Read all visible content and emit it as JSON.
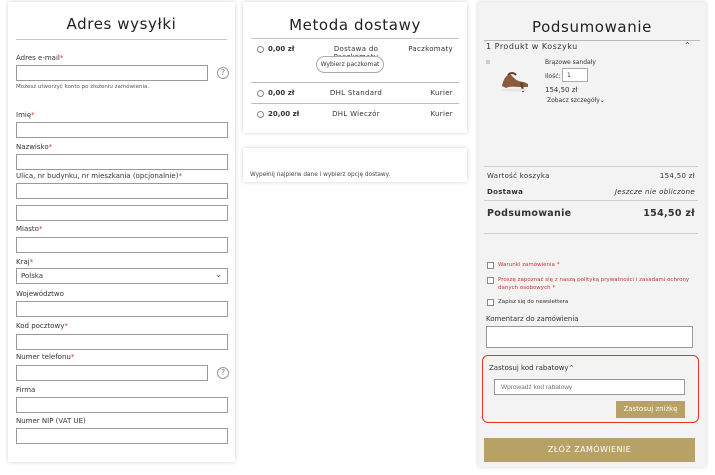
{
  "address": {
    "title": "Adres wysyłki",
    "email_label": "Adres e-mail",
    "email_hint": "Możesz utworzyć konto po złożeniu zamówienia.",
    "first_name_label": "Imię",
    "last_name_label": "Nazwisko",
    "street_label": "Ulica, nr budynku, nr mieszkania (opcjonalnie)",
    "city_label": "Miasto",
    "country_label": "Kraj",
    "country_value": "Polska",
    "region_label": "Województwo",
    "postcode_label": "Kod pocztowy",
    "phone_label": "Numer telefonu",
    "company_label": "Firma",
    "vat_label": "Numer NIP (VAT UE)",
    "required_mark": "*",
    "help_glyph": "?"
  },
  "shipping": {
    "title": "Metoda dostawy",
    "pick_button": "Wybierz paczkomat",
    "options": [
      {
        "price": "0,00 zł",
        "name": "Dostawa do Paczkomatu",
        "type": "Paczkomaty"
      },
      {
        "price": "0,00 zł",
        "name": "DHL Standard",
        "type": "Kurier"
      },
      {
        "price": "20,00 zł",
        "name": "DHL Wieczór",
        "type": "Kurier"
      }
    ],
    "info_text": "Wypełnij najpierw dane i wybierz opcję dostawy."
  },
  "summary": {
    "title": "Podsumowanie",
    "cart_header": "1 Produkt w Koszyku",
    "product_name": "Brązowe sandały",
    "qty_label": "Ilość:",
    "qty_value": "1",
    "product_price": "154,50 zł",
    "details_link": "Zobacz szczegóły",
    "cart_value_label": "Wartość koszyka",
    "cart_value": "154,50 zł",
    "delivery_label": "Dostawa",
    "delivery_value": "Jeszcze nie obliczone",
    "total_label": "Podsumowanie",
    "total_value": "154,50 zł",
    "terms_label": "Warunki zamówienia",
    "privacy_label": "Proszę zapoznać się z naszą polityką prywatności i zasadami ochrony danych osobowych",
    "newsletter_label": "Zapisz się do newslettera",
    "comment_label": "Komentarz do zamówienia",
    "discount_title": "Zastosuj kod rabatowy",
    "discount_placeholder": "Wprowadź kod rabatowy",
    "discount_button": "Zastosuj zniżkę",
    "order_button": "ZŁÓŻ ZAMÓWIENIE"
  },
  "colors": {
    "accent": "#b8a167",
    "required": "#c0392b",
    "highlight": "#e0391e"
  }
}
